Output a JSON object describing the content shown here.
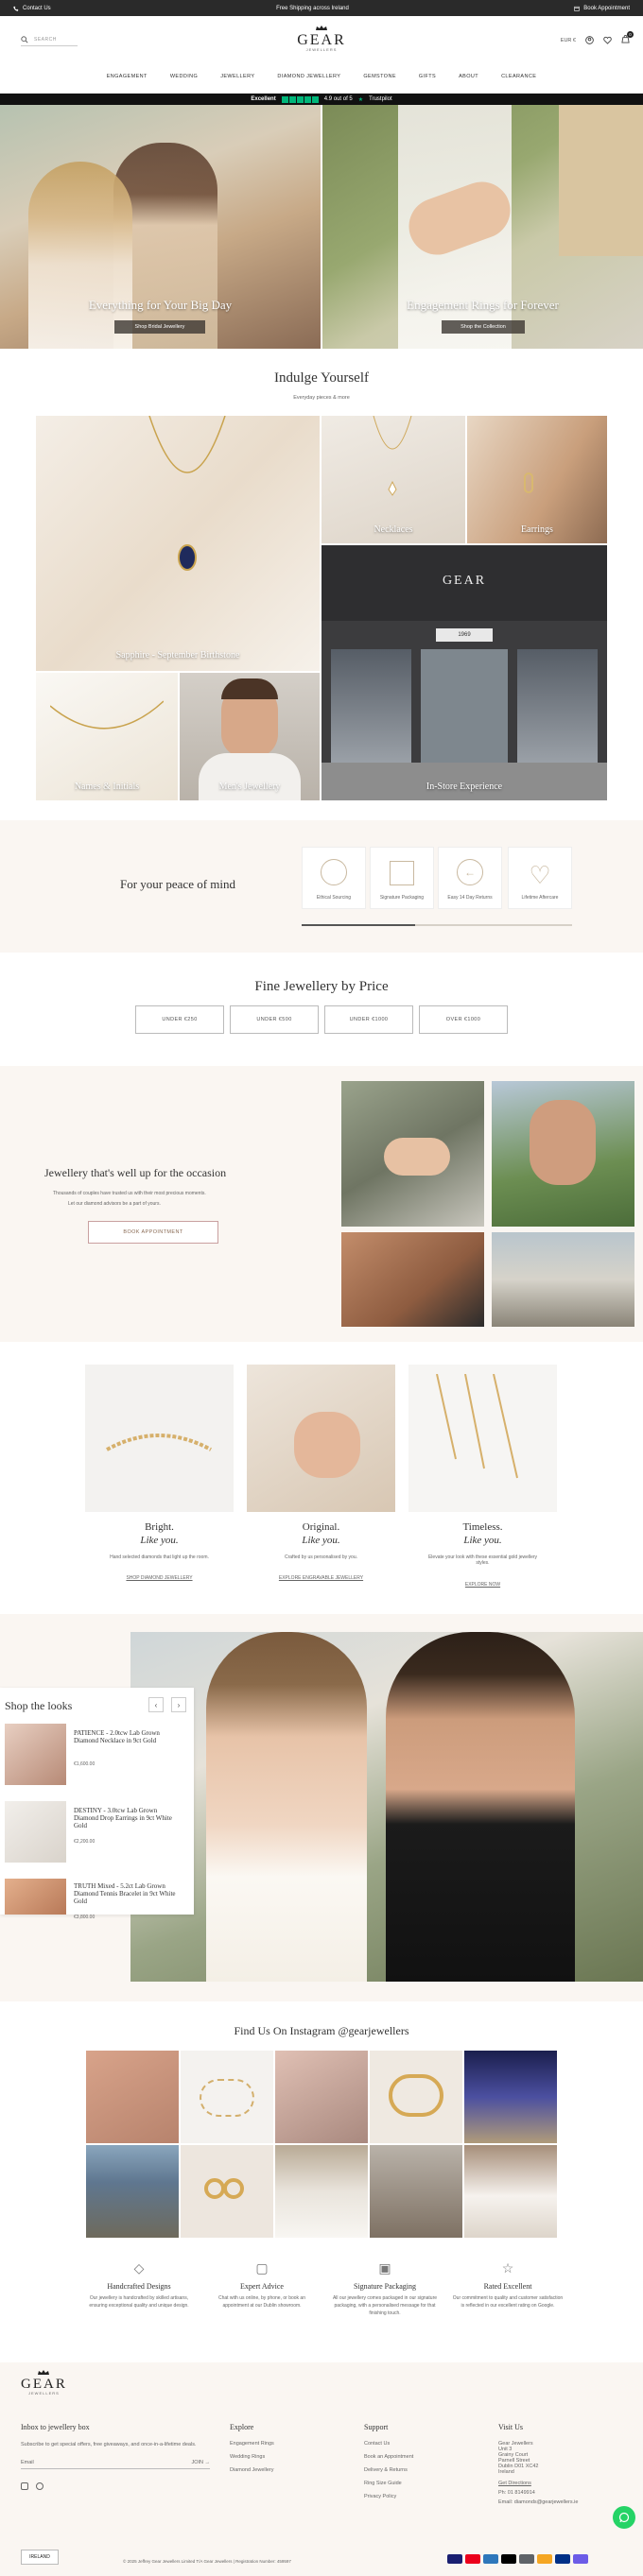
{
  "topbar": {
    "contact": "Contact Us",
    "shipping": "Free Shipping across Ireland",
    "appointment": "Book Appointment"
  },
  "header": {
    "search_placeholder": "SEARCH",
    "logo": "GEAR",
    "logo_sub": "JEWELLERS",
    "currency": "EUR €",
    "cart_count": "0"
  },
  "nav": [
    "ENGAGEMENT",
    "WEDDING",
    "JEWELLERY",
    "DIAMOND JEWELLERY",
    "GEMSTONE",
    "GIFTS",
    "ABOUT",
    "CLEARANCE"
  ],
  "trustpilot": {
    "label": "Excellent",
    "score": "4.9 out of 5",
    "brand": "Trustpilot"
  },
  "hero": {
    "left_title": "Everything for Your Big Day",
    "left_button": "Shop Bridal Jewellery",
    "right_title": "Engagement Rings for Forever",
    "right_button": "Shop the Collection"
  },
  "indulge": {
    "title": "Indulge Yourself",
    "subtitle": "Everyday pieces & more",
    "tiles": [
      "Sapphire - September Birthstone",
      "Necklaces",
      "Earrings",
      "Names & Initials",
      "Men's Jewellery",
      "In-Store Experience"
    ],
    "shopfront_name": "GEAR",
    "shopfront_sign": "1969"
  },
  "peace": {
    "title": "For your peace of mind",
    "cards": [
      "Ethical Sourcing",
      "Signature Packaging",
      "Easy 14 Day Returns",
      "Lifetime Aftercare"
    ]
  },
  "price": {
    "title": "Fine Jewellery by Price",
    "buttons": [
      "UNDER €250",
      "UNDER €500",
      "UNDER €1000",
      "OVER €1000"
    ]
  },
  "occasion": {
    "title": "Jewellery that's well up for the occasion",
    "text1": "Thousands of couples have trusted us with their most precious moments.",
    "text2": "Let our diamond advisors be a part of yours.",
    "button": "BOOK APPOINTMENT"
  },
  "bright": [
    {
      "title": "Bright.",
      "sub": "Like you.",
      "text": "Hand selected diamonds that light up the room.",
      "link": "SHOP DIAMOND JEWELLERY"
    },
    {
      "title": "Original.",
      "sub": "Like you.",
      "text": "Crafted by us personalised by you.",
      "link": "EXPLORE ENGRAVABLE JEWELLERY"
    },
    {
      "title": "Timeless.",
      "sub": "Like you.",
      "text": "Elevate your look with these essential gold jewellery styles.",
      "link": "EXPLORE NOW"
    }
  ],
  "looks": {
    "title": "Shop the looks",
    "items": [
      {
        "name": "PATIENCE - 2.0tcw Lab Grown Diamond Necklace in 9ct Gold",
        "price": "€1,600.00"
      },
      {
        "name": "DESTINY - 3.0tcw Lab Grown Diamond Drop Earrings in 9ct White Gold",
        "price": "€2,200.00"
      },
      {
        "name": "TRUTH Mixed - 5.2ct Lab Grown Diamond Tennis Bracelet in 9ct White Gold",
        "price": "€3,800.00"
      }
    ]
  },
  "instagram": {
    "title": "Find Us On Instagram @gearjewellers"
  },
  "features": [
    {
      "title": "Handcrafted Designs",
      "text": "Our jewellery is handcrafted by skilled artisans, ensuring exceptional quality and unique design."
    },
    {
      "title": "Expert Advice",
      "text": "Chat with us online, by phone, or book an appointment at our Dublin showroom."
    },
    {
      "title": "Signature Packaging",
      "text": "All our jewellery comes packaged in our signature packaging, with a personalised message for that finishing touch."
    },
    {
      "title": "Rated Excellent",
      "text": "Our commitment to quality and customer satisfaction is reflected in our excellent rating on Google."
    }
  ],
  "footer": {
    "logo": "GEAR",
    "logo_sub": "JEWELLERS",
    "newsletter_title": "Inbox to jewellery box",
    "newsletter_text": "Subscribe to get special offers, free giveaways, and once-in-a-lifetime deals.",
    "email_placeholder": "Email",
    "join": "JOIN",
    "explore_title": "Explore",
    "explore": [
      "Engagement Rings",
      "Wedding Rings",
      "Diamond Jewellery"
    ],
    "support_title": "Support",
    "support": [
      "Contact Us",
      "Book an Appointment",
      "Delivery & Returns",
      "Ring Size Guide",
      "Privacy Policy"
    ],
    "visit_title": "Visit Us",
    "address": [
      "Gear Jewellers",
      "Unit 3",
      "Grainy Court",
      "Parnell Street",
      "Dublin D01 XC42",
      "Ireland"
    ],
    "directions": "Get Directions",
    "phone": "Ph: 01 8149914",
    "email": "Email: diamonds@gearjewellers.ie",
    "country": "IRELAND",
    "copyright": "© 2025 Jeffrey Gear Jewellers Limited T/A Gear Jewellers | Registration Number: 459597"
  },
  "colors": {
    "cream": "#faf6f2",
    "accent": "#c9b9a0",
    "dark": "#2a2a2a",
    "whatsapp": "#25d366"
  }
}
